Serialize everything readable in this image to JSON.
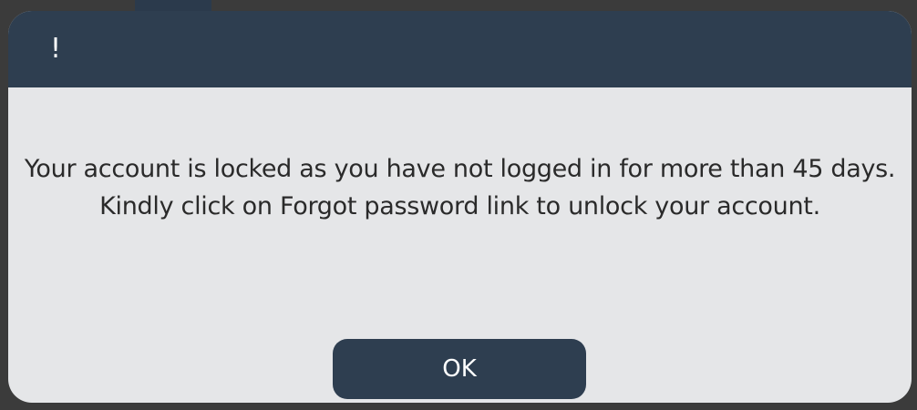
{
  "dialog": {
    "title": "!",
    "message": "Your account is locked as you have not logged in for more than 45 days. Kindly click on Forgot password link to unlock your account.",
    "ok_label": "OK"
  },
  "colors": {
    "header": "#2e3e50",
    "body": "#e5e6e8",
    "button": "#2e3e50",
    "text": "#2a2a2a"
  }
}
